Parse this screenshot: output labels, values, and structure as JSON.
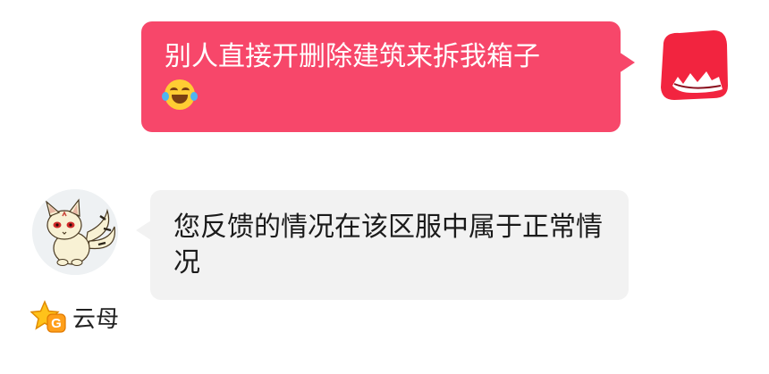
{
  "conversation": {
    "outgoing_message": {
      "text": "别人直接开删除建筑来拆我箱子",
      "emoji": "face-with-tears-of-joy",
      "bubble_color": "#f7476a",
      "text_color": "#ffffff"
    },
    "incoming_message": {
      "text": "您反馈的情况在该区服中属于正常情况",
      "bubble_color": "#f2f2f2",
      "text_color": "#1b1b1b"
    },
    "sender": {
      "name": "云母",
      "badge_letter": "G",
      "badge_icon": "star-badge-icon"
    }
  },
  "icons": {
    "outgoing_avatar": "red-monster-avatar-icon",
    "incoming_avatar": "kirara-cat-avatar-icon"
  }
}
